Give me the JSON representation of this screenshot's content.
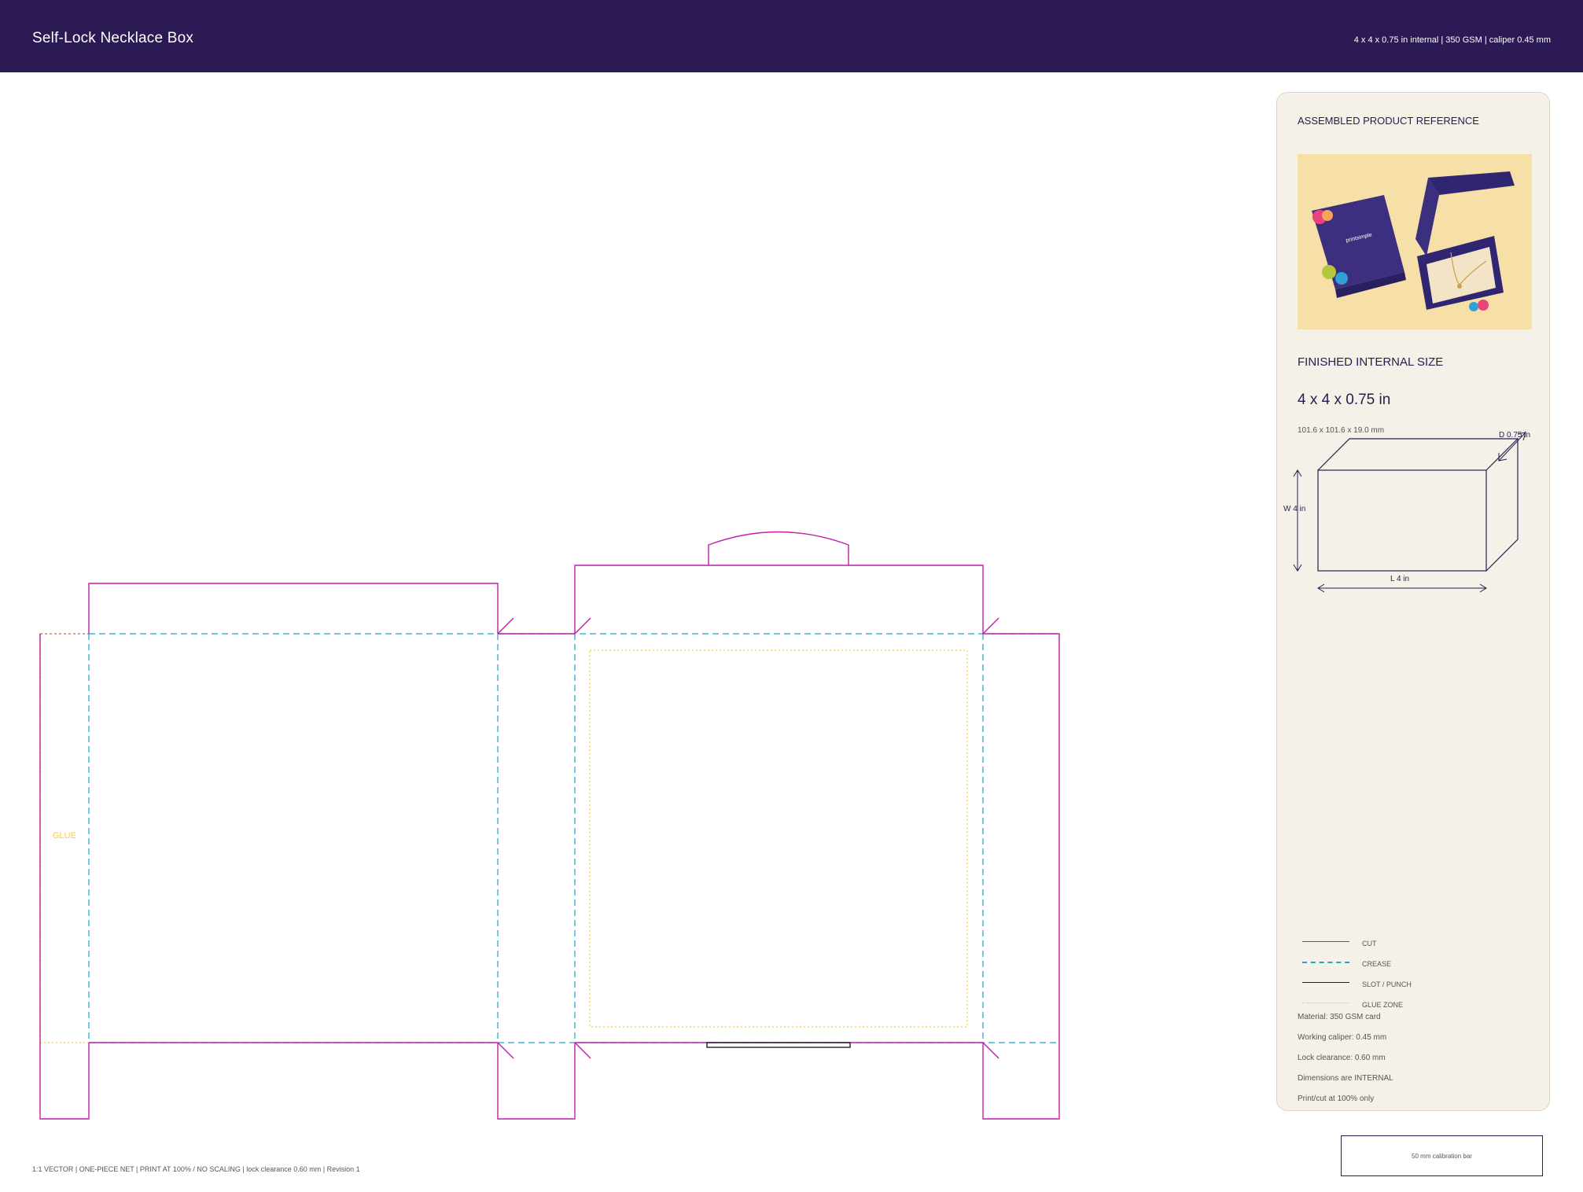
{
  "header": {
    "title": "Self-Lock Necklace Box",
    "spec": "4 x 4 x 0.75 in internal | 350 GSM | caliper 0.45 mm"
  },
  "dieline": {
    "glue_label": "GLUE"
  },
  "panel": {
    "ref_title": "ASSEMBLED PRODUCT REFERENCE",
    "photo_brand": "printsimple",
    "size_title": "FINISHED INTERNAL SIZE",
    "size_big": "4 x 4 x 0.75 in",
    "size_mm": "101.6 x 101.6 x 19.0 mm",
    "dim_d": "D 0.75 in",
    "dim_w": "W 4 in",
    "dim_l": "L 4 in"
  },
  "legend": {
    "items": [
      {
        "label": "CUT",
        "color": "#c21ea8",
        "style": "solid"
      },
      {
        "label": "CREASE",
        "color": "#1aa5c9",
        "style": "dashed"
      },
      {
        "label": "SLOT / PUNCH",
        "color": "#222222",
        "style": "solid"
      },
      {
        "label": "GLUE ZONE",
        "color": "#f2cb3a",
        "style": "dotted"
      }
    ]
  },
  "notes": [
    "Material: 350 GSM card",
    "Working caliper: 0.45 mm",
    "Lock clearance: 0.60 mm",
    "Dimensions are INTERNAL",
    "Print/cut at 100% only"
  ],
  "calibration": {
    "label": "50 mm calibration bar"
  },
  "footer": {
    "text": "1:1 VECTOR | ONE-PIECE NET | PRINT AT 100% / NO SCALING | lock clearance 0.60 mm | Revision 1"
  },
  "colors": {
    "cut": "#c21ea8",
    "crease": "#1aa5c9",
    "slot": "#222222",
    "glue": "#f2cb3a",
    "header": "#2c1a54"
  }
}
